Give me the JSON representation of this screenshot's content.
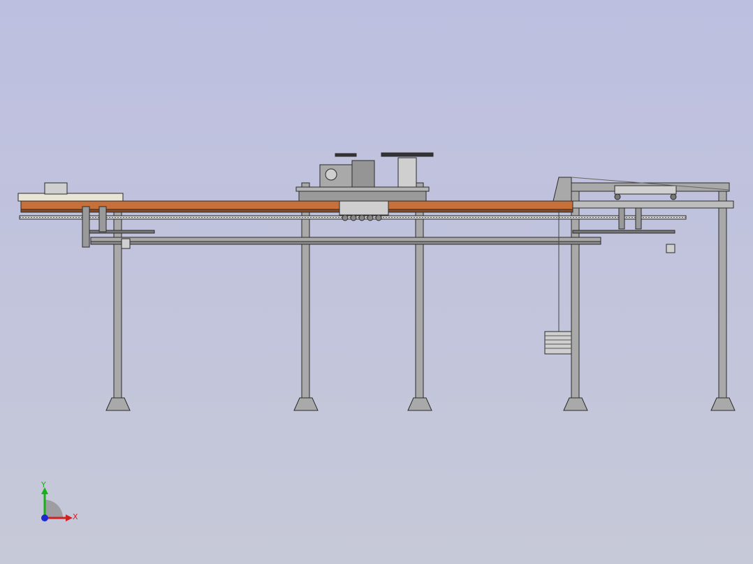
{
  "viewport": {
    "background_top": "#bdbfe0",
    "background_bottom": "#c6c9d8"
  },
  "colors": {
    "steel": "#a9a9a9",
    "steel_dark": "#6f6f6f",
    "outline": "#2a2a2a",
    "belt": "#c8703a",
    "belt_dark": "#8a4a22",
    "cream": "#e8e4d6"
  },
  "triad": {
    "x_label": "X",
    "y_label": "Y",
    "x_color": "#d22020",
    "y_color": "#18b018",
    "z_color": "#1a2ad0"
  }
}
